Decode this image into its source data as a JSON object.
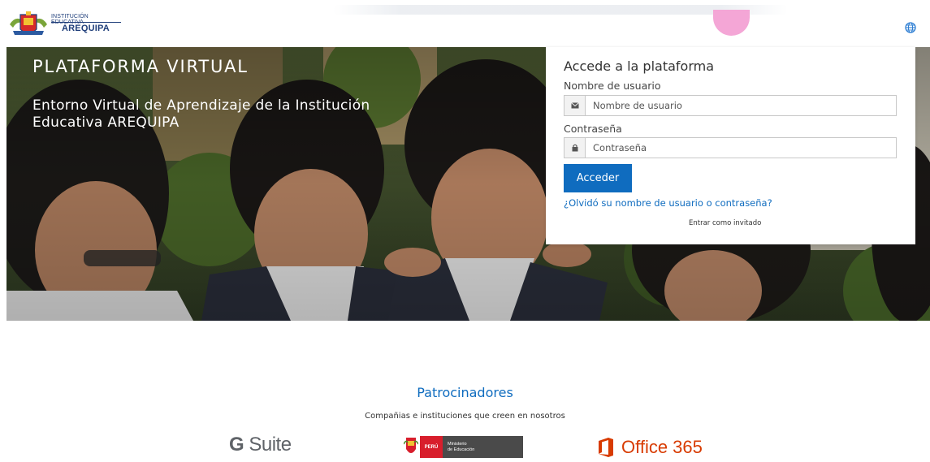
{
  "header": {
    "logo_small_text": "INSTITUCIÓN EDUCATIVA",
    "logo_big_text": "AREQUIPA",
    "language_icon": "globe-icon"
  },
  "hero": {
    "title": "PLATAFORMA VIRTUAL",
    "subtitle": "Entorno Virtual de Aprendizaje de la Institución Educativa AREQUIPA"
  },
  "login": {
    "title": "Accede a la plataforma",
    "username_label": "Nombre de usuario",
    "username_placeholder": "Nombre de usuario",
    "username_icon": "envelope-icon",
    "password_label": "Contraseña",
    "password_placeholder": "Contraseña",
    "password_icon": "lock-icon",
    "submit_label": "Acceder",
    "forgot_link": "¿Olvidó su nombre de usuario o contraseña?",
    "guest_link": "Entrar como invitado"
  },
  "sponsors": {
    "title": "Patrocinadores",
    "subtitle": "Compañias e instituciones que creen en nosotros",
    "gsuite_bold": "G",
    "gsuite_rest": " Suite",
    "minedu_red_text": "PERÚ",
    "minedu_grey_line1": "Ministerio",
    "minedu_grey_line2": "de Educación",
    "office_text": "Office 365"
  },
  "colors": {
    "primary": "#0f6cbf",
    "office_orange": "#d83b01",
    "peru_red": "#d81e2c"
  }
}
